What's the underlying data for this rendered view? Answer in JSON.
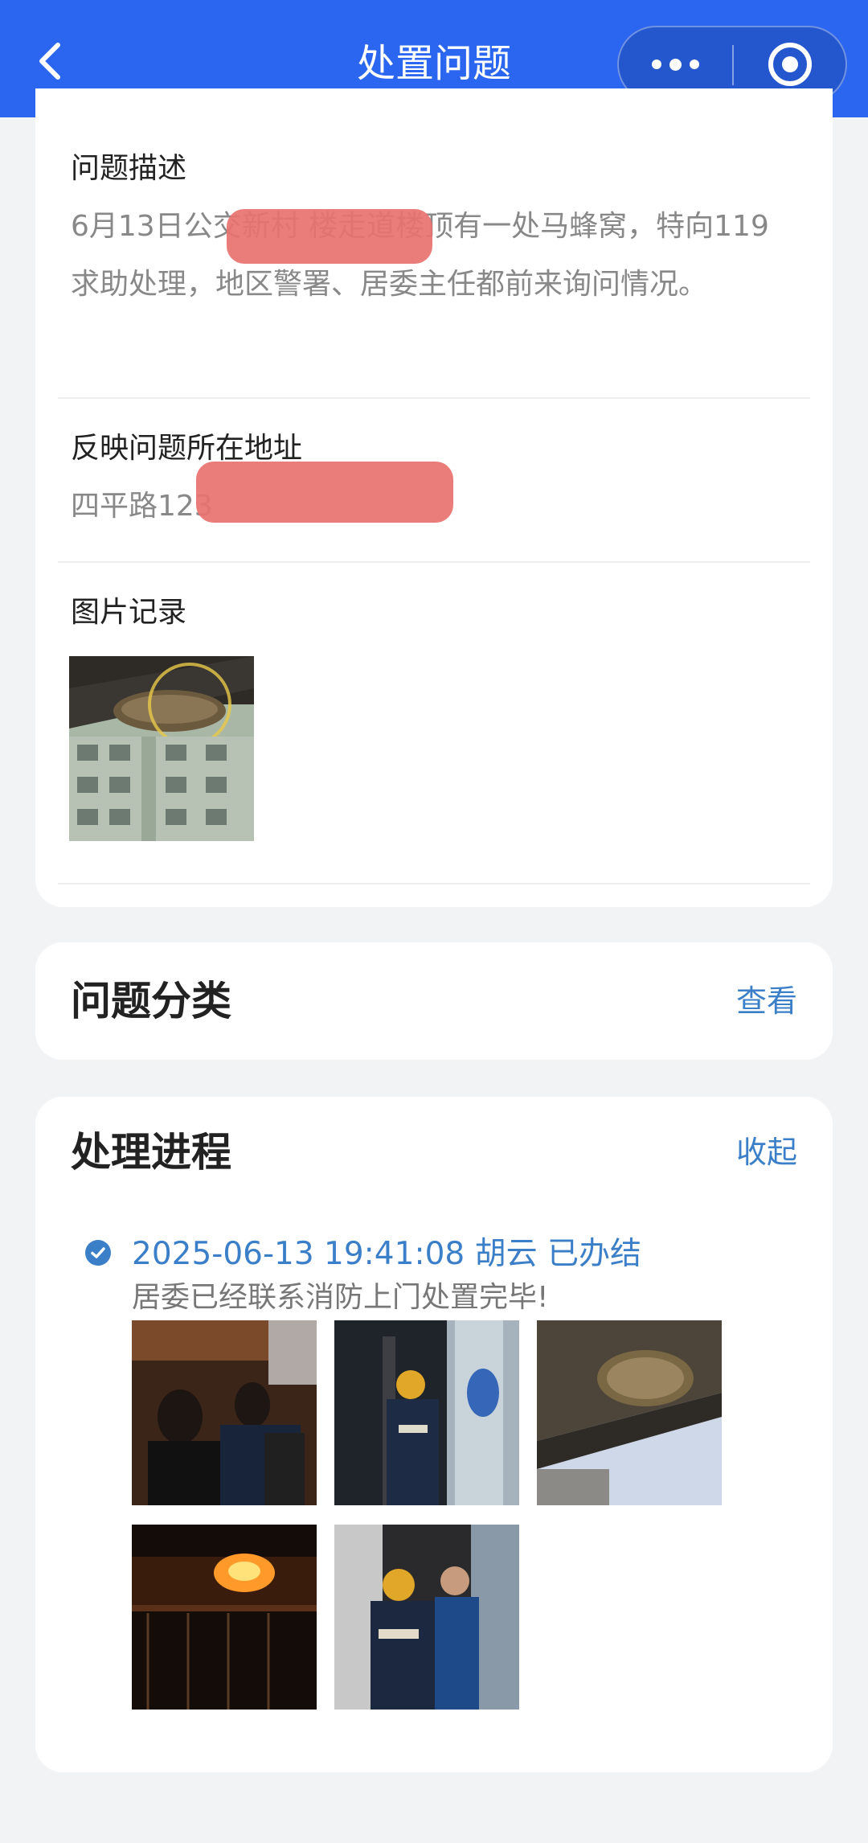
{
  "header": {
    "title": "处置问题",
    "back_icon": "chevron-left-icon",
    "more_icon": "more-dots-icon",
    "close_icon": "target-circle-icon",
    "background": "#2b66f0"
  },
  "problem_card": {
    "description_label": "问题描述",
    "description_text": "6月13日公交新村 楼走道楼顶有一处马蜂窝，特向119求助处理，地区警署、居委主任都前来询问情况。",
    "address_label": "反映问题所在地址",
    "address_text": "四平路123",
    "photos_label": "图片记录",
    "photos": [
      {
        "name": "wasp-nest-on-building-photo"
      }
    ]
  },
  "category_card": {
    "title": "问题分类",
    "action": "查看"
  },
  "progress_card": {
    "title": "处理进程",
    "action": "收起",
    "entries": [
      {
        "datetime": "2025-06-13 19:41:08",
        "handler": "胡云",
        "status": "已办结",
        "description": "居委已经联系消防上门处置完毕!",
        "photos": [
          {
            "name": "residents-in-hallway-photo"
          },
          {
            "name": "firefighter-in-corridor-photo"
          },
          {
            "name": "wasp-nest-under-ledge-photo"
          },
          {
            "name": "burning-nest-at-night-photo"
          },
          {
            "name": "firefighters-with-resident-photo"
          }
        ]
      }
    ]
  },
  "colors": {
    "accent": "#2b66f0",
    "link": "#3b7fc9",
    "page_background": "#f2f3f5",
    "redaction": "#e8716f"
  }
}
